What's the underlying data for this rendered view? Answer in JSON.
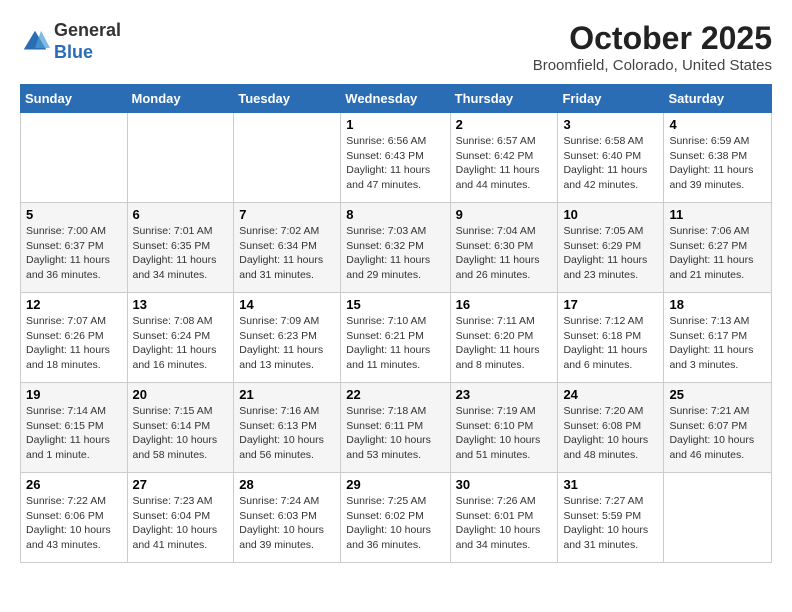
{
  "logo": {
    "general": "General",
    "blue": "Blue"
  },
  "title": "October 2025",
  "location": "Broomfield, Colorado, United States",
  "days_of_week": [
    "Sunday",
    "Monday",
    "Tuesday",
    "Wednesday",
    "Thursday",
    "Friday",
    "Saturday"
  ],
  "weeks": [
    [
      {
        "day": "",
        "info": ""
      },
      {
        "day": "",
        "info": ""
      },
      {
        "day": "",
        "info": ""
      },
      {
        "day": "1",
        "info": "Sunrise: 6:56 AM\nSunset: 6:43 PM\nDaylight: 11 hours and 47 minutes."
      },
      {
        "day": "2",
        "info": "Sunrise: 6:57 AM\nSunset: 6:42 PM\nDaylight: 11 hours and 44 minutes."
      },
      {
        "day": "3",
        "info": "Sunrise: 6:58 AM\nSunset: 6:40 PM\nDaylight: 11 hours and 42 minutes."
      },
      {
        "day": "4",
        "info": "Sunrise: 6:59 AM\nSunset: 6:38 PM\nDaylight: 11 hours and 39 minutes."
      }
    ],
    [
      {
        "day": "5",
        "info": "Sunrise: 7:00 AM\nSunset: 6:37 PM\nDaylight: 11 hours and 36 minutes."
      },
      {
        "day": "6",
        "info": "Sunrise: 7:01 AM\nSunset: 6:35 PM\nDaylight: 11 hours and 34 minutes."
      },
      {
        "day": "7",
        "info": "Sunrise: 7:02 AM\nSunset: 6:34 PM\nDaylight: 11 hours and 31 minutes."
      },
      {
        "day": "8",
        "info": "Sunrise: 7:03 AM\nSunset: 6:32 PM\nDaylight: 11 hours and 29 minutes."
      },
      {
        "day": "9",
        "info": "Sunrise: 7:04 AM\nSunset: 6:30 PM\nDaylight: 11 hours and 26 minutes."
      },
      {
        "day": "10",
        "info": "Sunrise: 7:05 AM\nSunset: 6:29 PM\nDaylight: 11 hours and 23 minutes."
      },
      {
        "day": "11",
        "info": "Sunrise: 7:06 AM\nSunset: 6:27 PM\nDaylight: 11 hours and 21 minutes."
      }
    ],
    [
      {
        "day": "12",
        "info": "Sunrise: 7:07 AM\nSunset: 6:26 PM\nDaylight: 11 hours and 18 minutes."
      },
      {
        "day": "13",
        "info": "Sunrise: 7:08 AM\nSunset: 6:24 PM\nDaylight: 11 hours and 16 minutes."
      },
      {
        "day": "14",
        "info": "Sunrise: 7:09 AM\nSunset: 6:23 PM\nDaylight: 11 hours and 13 minutes."
      },
      {
        "day": "15",
        "info": "Sunrise: 7:10 AM\nSunset: 6:21 PM\nDaylight: 11 hours and 11 minutes."
      },
      {
        "day": "16",
        "info": "Sunrise: 7:11 AM\nSunset: 6:20 PM\nDaylight: 11 hours and 8 minutes."
      },
      {
        "day": "17",
        "info": "Sunrise: 7:12 AM\nSunset: 6:18 PM\nDaylight: 11 hours and 6 minutes."
      },
      {
        "day": "18",
        "info": "Sunrise: 7:13 AM\nSunset: 6:17 PM\nDaylight: 11 hours and 3 minutes."
      }
    ],
    [
      {
        "day": "19",
        "info": "Sunrise: 7:14 AM\nSunset: 6:15 PM\nDaylight: 11 hours and 1 minute."
      },
      {
        "day": "20",
        "info": "Sunrise: 7:15 AM\nSunset: 6:14 PM\nDaylight: 10 hours and 58 minutes."
      },
      {
        "day": "21",
        "info": "Sunrise: 7:16 AM\nSunset: 6:13 PM\nDaylight: 10 hours and 56 minutes."
      },
      {
        "day": "22",
        "info": "Sunrise: 7:18 AM\nSunset: 6:11 PM\nDaylight: 10 hours and 53 minutes."
      },
      {
        "day": "23",
        "info": "Sunrise: 7:19 AM\nSunset: 6:10 PM\nDaylight: 10 hours and 51 minutes."
      },
      {
        "day": "24",
        "info": "Sunrise: 7:20 AM\nSunset: 6:08 PM\nDaylight: 10 hours and 48 minutes."
      },
      {
        "day": "25",
        "info": "Sunrise: 7:21 AM\nSunset: 6:07 PM\nDaylight: 10 hours and 46 minutes."
      }
    ],
    [
      {
        "day": "26",
        "info": "Sunrise: 7:22 AM\nSunset: 6:06 PM\nDaylight: 10 hours and 43 minutes."
      },
      {
        "day": "27",
        "info": "Sunrise: 7:23 AM\nSunset: 6:04 PM\nDaylight: 10 hours and 41 minutes."
      },
      {
        "day": "28",
        "info": "Sunrise: 7:24 AM\nSunset: 6:03 PM\nDaylight: 10 hours and 39 minutes."
      },
      {
        "day": "29",
        "info": "Sunrise: 7:25 AM\nSunset: 6:02 PM\nDaylight: 10 hours and 36 minutes."
      },
      {
        "day": "30",
        "info": "Sunrise: 7:26 AM\nSunset: 6:01 PM\nDaylight: 10 hours and 34 minutes."
      },
      {
        "day": "31",
        "info": "Sunrise: 7:27 AM\nSunset: 5:59 PM\nDaylight: 10 hours and 31 minutes."
      },
      {
        "day": "",
        "info": ""
      }
    ]
  ]
}
